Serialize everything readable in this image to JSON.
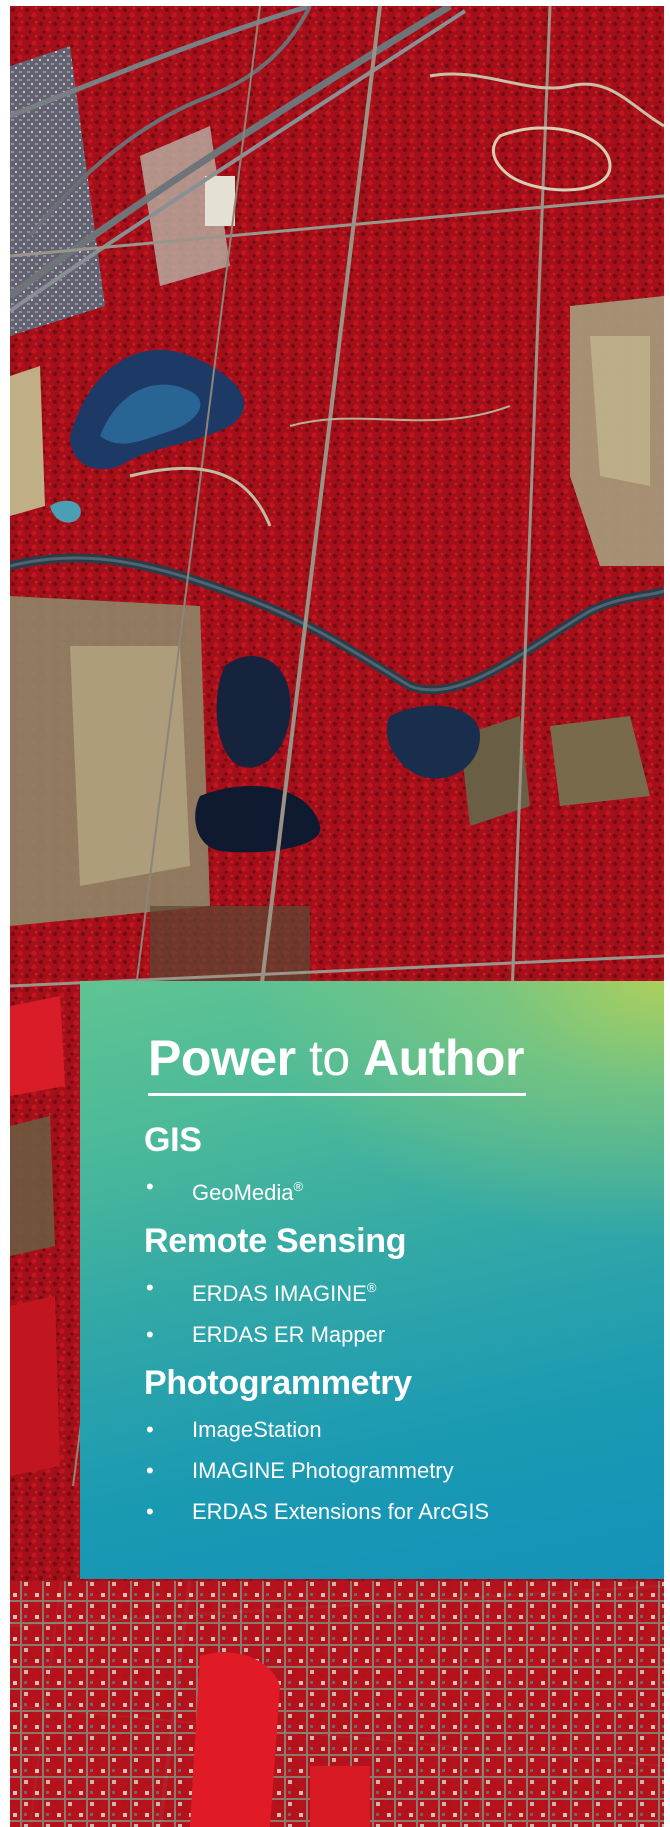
{
  "colors": {
    "panel_gradient_top": "#a6cf63",
    "panel_gradient_mid": "#3aae9e",
    "panel_gradient_bottom": "#1592b8",
    "imagery_vegetation": "#b5121b",
    "text": "#ffffff"
  },
  "panel": {
    "title_word_1": "Power",
    "title_word_2": "to",
    "title_word_3": "Author",
    "sections": [
      {
        "heading": "GIS",
        "items": [
          {
            "text": "GeoMedia",
            "mark": "®"
          }
        ]
      },
      {
        "heading": "Remote Sensing",
        "items": [
          {
            "text": "ERDAS IMAGINE",
            "mark": "®"
          },
          {
            "text": "ERDAS ER Mapper",
            "mark": ""
          }
        ]
      },
      {
        "heading": "Photogrammetry",
        "items": [
          {
            "text": "ImageStation",
            "mark": ""
          },
          {
            "text": "IMAGINE Photogrammetry",
            "mark": ""
          },
          {
            "text": "ERDAS Extensions for ArcGIS",
            "mark": ""
          }
        ]
      }
    ],
    "bullet_glyph": "•"
  }
}
